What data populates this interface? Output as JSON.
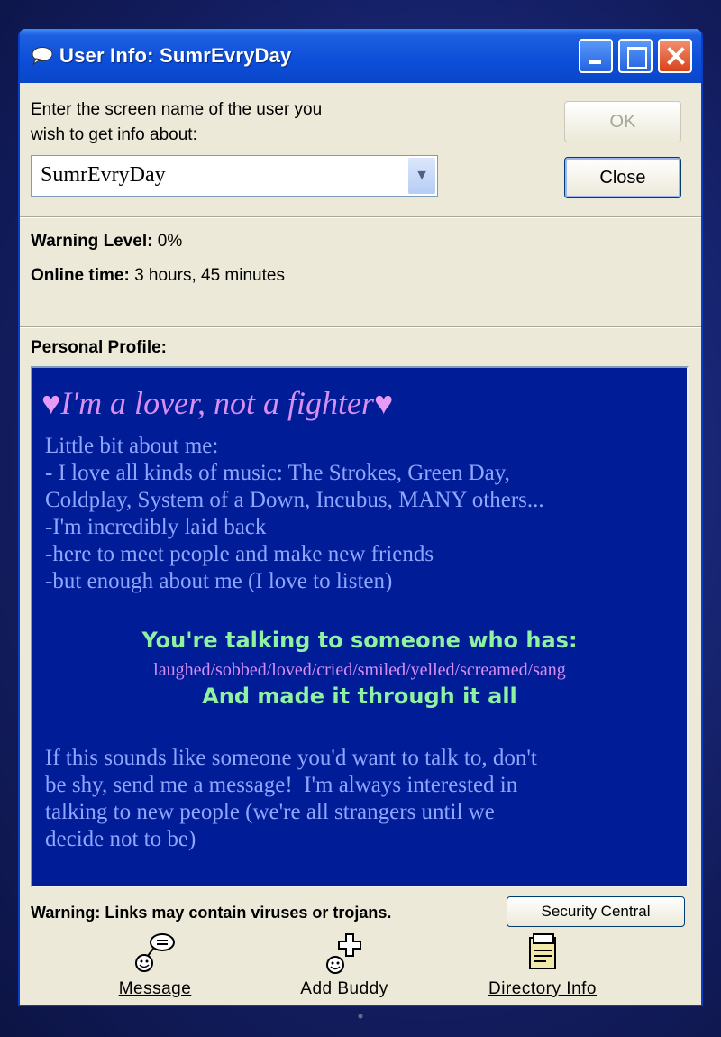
{
  "window": {
    "title": "User Info: SumrEvryDay"
  },
  "prompt": {
    "line1": "Enter the screen name of the user you",
    "line2": "wish to get info about:",
    "screen_name_value": "SumrEvryDay"
  },
  "buttons": {
    "ok": "OK",
    "close": "Close",
    "security_central": "Security Central"
  },
  "info": {
    "warning_label": "Warning Level:",
    "warning_value": "0%",
    "online_label": "Online time:",
    "online_value": "3 hours, 45 minutes"
  },
  "profile": {
    "section_label": "Personal Profile:",
    "heart": "♥",
    "headline": "I'm a lover, not a fighter",
    "about": [
      "Little bit about me:",
      "- I love all kinds of music: The Strokes, Green Day,",
      "Coldplay, System of a Down, Incubus, MANY others...",
      "-I'm incredibly laid back",
      "-here to meet people and make new friends",
      "-but enough about me (I love to listen)"
    ],
    "green1": "You're talking to someone who has:",
    "pink": "laughed/sobbed/loved/cried/smiled/yelled/screamed/sang",
    "green2": "And made it through it all",
    "closing": [
      "If this sounds like someone you'd want to talk to, don't",
      "be shy, send me a message!  I'm always interested in",
      "talking to new people (we're all strangers until we",
      "decide not to be)"
    ]
  },
  "warning_links": "Warning: Links may contain viruses or trojans.",
  "actions": {
    "message": "Message",
    "add_buddy": "Add Buddy",
    "directory_info": "Directory Info"
  }
}
